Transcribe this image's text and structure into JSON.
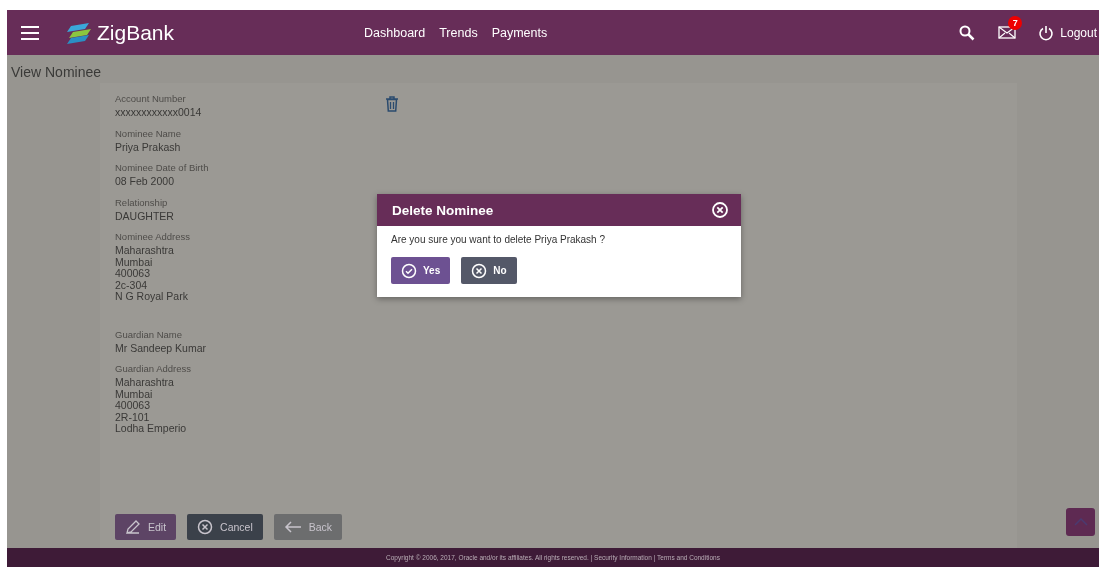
{
  "header": {
    "brand": "ZigBank",
    "nav": [
      "Dashboard",
      "Trends",
      "Payments"
    ],
    "mail_badge": "7",
    "logout": "Logout"
  },
  "page_title": "View Nominee",
  "sections": [
    [
      {
        "label": "Account Number",
        "lines": [
          "xxxxxxxxxxxx0014"
        ]
      },
      {
        "label": "Nominee Name",
        "lines": [
          "Priya Prakash"
        ]
      },
      {
        "label": "Nominee Date of Birth",
        "lines": [
          "08 Feb 2000"
        ]
      },
      {
        "label": "Relationship",
        "lines": [
          "DAUGHTER"
        ]
      },
      {
        "label": "Nominee Address",
        "lines": [
          "Maharashtra",
          "Mumbai",
          "400063",
          "2c-304",
          "N G Royal Park"
        ]
      }
    ],
    [
      {
        "label": "Guardian Name",
        "lines": [
          "Mr Sandeep Kumar"
        ]
      },
      {
        "label": "Guardian Address",
        "lines": [
          "Maharashtra",
          "Mumbai",
          "400063",
          "2R-101",
          "Lodha Emperio"
        ]
      }
    ]
  ],
  "actions": [
    {
      "kind": "edit",
      "label": "Edit"
    },
    {
      "kind": "cancel",
      "label": "Cancel"
    },
    {
      "kind": "back",
      "label": "Back"
    }
  ],
  "dialog": {
    "title": "Delete Nominee",
    "message": "Are you sure you want to delete Priya Prakash ?",
    "buttons": [
      {
        "kind": "yes",
        "label": "Yes"
      },
      {
        "kind": "no",
        "label": "No"
      }
    ]
  },
  "footer": {
    "copyright": "Copyright © 2006, 2017, Oracle and/or its affiliates. All rights reserved.",
    "separator": "|",
    "links": [
      "Security Information",
      "Terms and Conditions"
    ]
  }
}
